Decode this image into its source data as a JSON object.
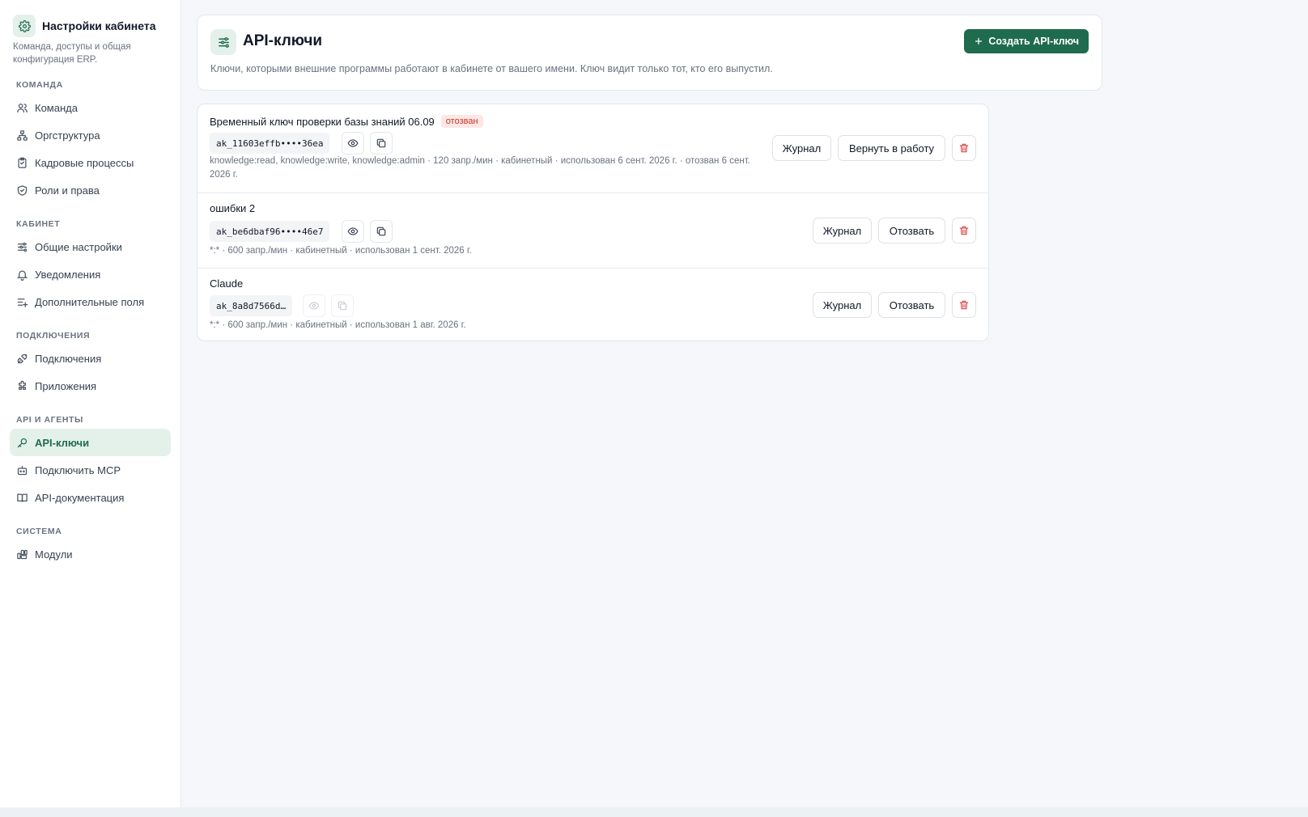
{
  "sidebar": {
    "title": "Настройки кабинета",
    "subtitle": "Команда, доступы и общая конфигурация ERP.",
    "sections": [
      {
        "label": "КОМАНДА",
        "items": [
          {
            "label": "Команда",
            "icon": "users-icon"
          },
          {
            "label": "Оргструктура",
            "icon": "org-chart-icon"
          },
          {
            "label": "Кадровые процессы",
            "icon": "clipboard-icon"
          },
          {
            "label": "Роли и права",
            "icon": "shield-check-icon"
          }
        ]
      },
      {
        "label": "КАБИНЕТ",
        "items": [
          {
            "label": "Общие настройки",
            "icon": "sliders-icon"
          },
          {
            "label": "Уведомления",
            "icon": "bell-icon"
          },
          {
            "label": "Дополнительные поля",
            "icon": "list-plus-icon"
          }
        ]
      },
      {
        "label": "ПОДКЛЮЧЕНИЯ",
        "items": [
          {
            "label": "Подключения",
            "icon": "plug-icon"
          },
          {
            "label": "Приложения",
            "icon": "puzzle-icon"
          }
        ]
      },
      {
        "label": "API И АГЕНТЫ",
        "items": [
          {
            "label": "API-ключи",
            "icon": "key-icon",
            "active": true
          },
          {
            "label": "Подключить MCP",
            "icon": "bot-icon"
          },
          {
            "label": "API-документация",
            "icon": "book-icon"
          }
        ]
      },
      {
        "label": "СИСТЕМА",
        "items": [
          {
            "label": "Модули",
            "icon": "modules-icon"
          }
        ]
      }
    ]
  },
  "header": {
    "title": "API-ключи",
    "description": "Ключи, которыми внешние программы работают в кабинете от вашего имени. Ключ видит только тот, кто его выпустил.",
    "create_label": "Создать API-ключ"
  },
  "keys": [
    {
      "name": "Временный ключ проверки базы знаний 06.09",
      "badge": "отозван",
      "token": "ak_11603effb••••36ea",
      "meta": "knowledge:read, knowledge:write, knowledge:admin · 120 запр./мин · кабинетный · использован 6 сент. 2026 г. · отозван 6 сент. 2026 г.",
      "log_label": "Журнал",
      "action_label": "Вернуть в работу"
    },
    {
      "name": "ошибки 2",
      "token": "ak_be6dbaf96••••46e7",
      "meta": "*:* · 600 запр./мин · кабинетный · использован 1 сент. 2026 г.",
      "log_label": "Журнал",
      "action_label": "Отозвать"
    },
    {
      "name": "Claude",
      "token": "ak_8a8d7566d…",
      "meta": "*:* · 600 запр./мин · кабинетный · использован 1 авг. 2026 г.",
      "log_label": "Журнал",
      "action_label": "Отозвать"
    }
  ],
  "colors": {
    "accent": "#1f6b4e",
    "accent_soft": "#e3f1ea",
    "danger": "#d64545",
    "badge_bg": "#fde7e5"
  }
}
